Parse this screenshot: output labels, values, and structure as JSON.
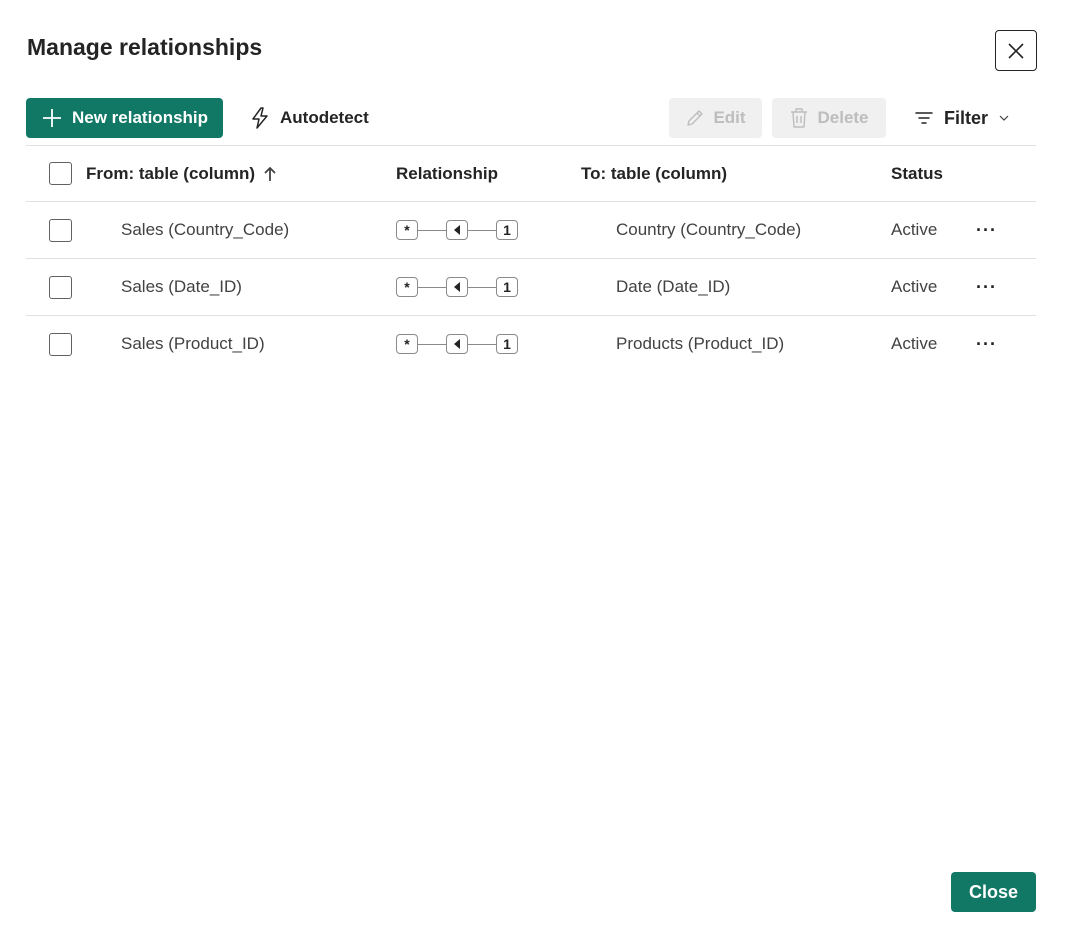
{
  "dialog": {
    "title": "Manage relationships"
  },
  "toolbar": {
    "new_relationship": "New relationship",
    "autodetect": "Autodetect",
    "edit": "Edit",
    "delete": "Delete",
    "filter": "Filter"
  },
  "table": {
    "columns": {
      "from": "From: table (column)",
      "relationship": "Relationship",
      "to": "To: table (column)",
      "status": "Status"
    },
    "rows": [
      {
        "from": "Sales (Country_Code)",
        "to": "Country (Country_Code)",
        "status": "Active",
        "from_card": "*",
        "to_card": "1"
      },
      {
        "from": "Sales (Date_ID)",
        "to": "Date (Date_ID)",
        "status": "Active",
        "from_card": "*",
        "to_card": "1"
      },
      {
        "from": "Sales (Product_ID)",
        "to": "Products (Product_ID)",
        "status": "Active",
        "from_card": "*",
        "to_card": "1"
      }
    ],
    "more_label": "···"
  },
  "footer": {
    "close": "Close"
  },
  "colors": {
    "accent": "#117865",
    "disabled_bg": "#f0f0f0",
    "disabled_text": "#bdbdbd"
  }
}
